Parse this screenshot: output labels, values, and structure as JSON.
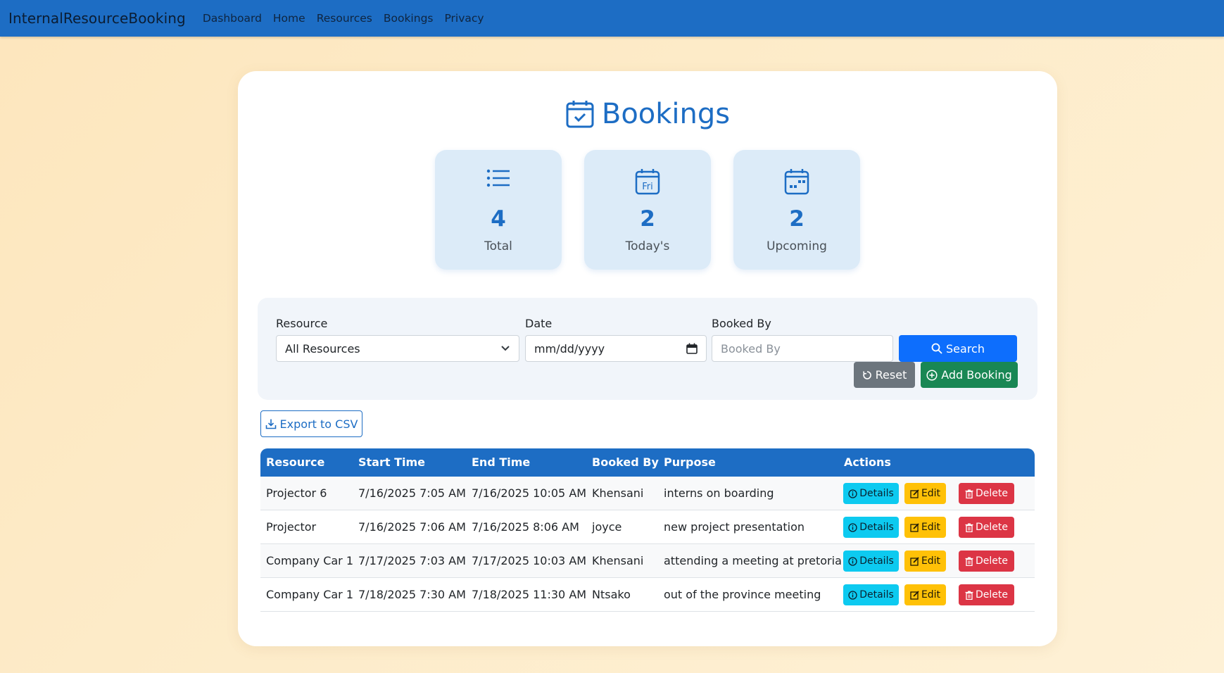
{
  "navbar": {
    "brand": "InternalResourceBooking",
    "links": [
      "Dashboard",
      "Home",
      "Resources",
      "Bookings",
      "Privacy"
    ]
  },
  "page": {
    "title": "Bookings"
  },
  "stats": [
    {
      "value": "4",
      "label": "Total",
      "icon": "list-icon"
    },
    {
      "value": "2",
      "label": "Today's",
      "icon": "calendar-day-icon",
      "icon_text": "Fri"
    },
    {
      "value": "2",
      "label": "Upcoming",
      "icon": "calendar-week-icon"
    }
  ],
  "filters": {
    "resource_label": "Resource",
    "resource_value": "All Resources",
    "date_label": "Date",
    "date_placeholder": "mm/dd/yyyy",
    "booked_by_label": "Booked By",
    "booked_by_placeholder": "Booked By",
    "search_label": "Search",
    "reset_label": "Reset",
    "add_label": "Add Booking"
  },
  "export_label": "Export to CSV",
  "table": {
    "headers": [
      "Resource",
      "Start Time",
      "End Time",
      "Booked By",
      "Purpose",
      "Actions"
    ],
    "rows": [
      {
        "resource": "Projector 6",
        "start": "7/16/2025 7:05 AM",
        "end": "7/16/2025 10:05 AM",
        "booked_by": "Khensani",
        "purpose": "interns on boarding"
      },
      {
        "resource": "Projector",
        "start": "7/16/2025 7:06 AM",
        "end": "7/16/2025 8:06 AM",
        "booked_by": "joyce",
        "purpose": "new project presentation"
      },
      {
        "resource": "Company Car 1",
        "start": "7/17/2025 7:03 AM",
        "end": "7/17/2025 10:03 AM",
        "booked_by": "Khensani",
        "purpose": "attending a meeting at pretoria"
      },
      {
        "resource": "Company Car 1",
        "start": "7/18/2025 7:30 AM",
        "end": "7/18/2025 11:30 AM",
        "booked_by": "Ntsako",
        "purpose": "out of the province meeting"
      }
    ],
    "actions": {
      "details": "Details",
      "edit": "Edit",
      "delete": "Delete"
    }
  },
  "colors": {
    "primary": "#1d6dc4",
    "search": "#0d6efd",
    "reset": "#6c757d",
    "add": "#198754",
    "details": "#0dcaf0",
    "edit": "#ffc107",
    "delete": "#dc3545"
  }
}
